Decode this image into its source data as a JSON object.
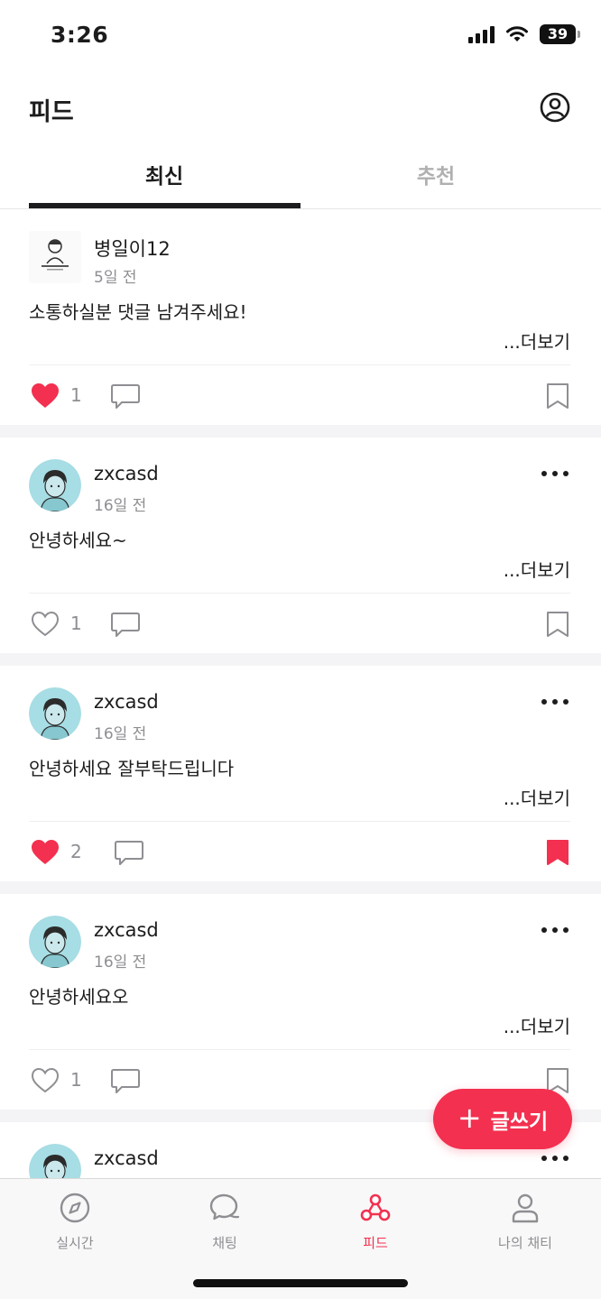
{
  "status_bar": {
    "time": "3:26",
    "battery": "39"
  },
  "header": {
    "title": "피드"
  },
  "tabs": [
    {
      "label": "최신",
      "active": true
    },
    {
      "label": "추천",
      "active": false
    }
  ],
  "posts": [
    {
      "author": "병일이12",
      "time": "5일 전",
      "content": "소통하실분 댓글 남겨주세요!",
      "see_more": "...더보기",
      "likes": "1",
      "liked": true,
      "bookmarked": false
    },
    {
      "author": "zxcasd",
      "time": "16일 전",
      "content": "안녕하세요~",
      "see_more": "...더보기",
      "likes": "1",
      "liked": false,
      "bookmarked": false
    },
    {
      "author": "zxcasd",
      "time": "16일 전",
      "content": "안녕하세요 잘부탁드립니다",
      "see_more": "...더보기",
      "likes": "2",
      "liked": true,
      "bookmarked": true
    },
    {
      "author": "zxcasd",
      "time": "16일 전",
      "content": "안녕하세요오",
      "see_more": "...더보기",
      "likes": "1",
      "liked": false,
      "bookmarked": false
    },
    {
      "author": "zxcasd"
    }
  ],
  "fab": {
    "label": "글쓰기",
    "icon": "plus-icon"
  },
  "bottom_nav": [
    {
      "label": "실시간",
      "icon": "compass-icon",
      "active": false
    },
    {
      "label": "채팅",
      "icon": "chat-bubbles-icon",
      "active": false
    },
    {
      "label": "피드",
      "icon": "feed-network-icon",
      "active": true
    },
    {
      "label": "나의 채티",
      "icon": "person-icon",
      "active": false
    }
  ],
  "colors": {
    "accent": "#f3304f",
    "text": "#1c1c1e",
    "muted": "#8e8e93",
    "separator": "#f4f4f6"
  }
}
